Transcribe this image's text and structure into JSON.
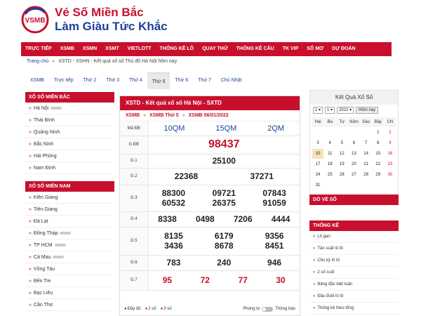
{
  "brand": {
    "logo_text": "VSMB",
    "line1": "Vé Số Miền Bắc",
    "line2": "Làm Giàu Tức Khắc"
  },
  "nav": [
    "TRỰC TIẾP",
    "XSMB",
    "XSMN",
    "XSMT",
    "VIETLOTT",
    "THỐNG KÊ LÔ",
    "QUAY THỬ",
    "THỐNG KÊ CẦU",
    "TK VIP",
    "SỔ MƠ",
    "DỰ ĐOÁN"
  ],
  "breadcrumb": {
    "home": "Trang chủ",
    "current": "XSTD - XSHN - Kết quả xổ số Thủ đô Hà Nội hôm nay"
  },
  "tabs": [
    "XSMB",
    "Trực tiếp",
    "Thứ 2",
    "Thứ 3",
    "Thứ 4",
    "Thứ 5",
    "Thứ 6",
    "Thứ 7",
    "Chủ Nhật"
  ],
  "active_tab": "Thứ 5",
  "sidebar_north": {
    "title": "XỔ SỐ MIỀN BẮC",
    "items": [
      "Hà Nội",
      "Thái Bình",
      "Quảng Ninh",
      "Bắc Ninh",
      "Hải Phòng",
      "Nam Định"
    ]
  },
  "sidebar_south": {
    "title": "XỔ SỐ MIỀN NAM",
    "items": [
      "Kiên Giang",
      "Tiền Giang",
      "Đà Lạt",
      "Đồng Tháp",
      "TP HCM",
      "Cà Mau",
      "Vũng Tàu",
      "Bến Tre",
      "Bạc Liêu",
      "Cần Thơ"
    ]
  },
  "result": {
    "header": "XSTD - Kết quả xổ số Hà Nội - SXTD",
    "sub1": "XSMB",
    "sub2": "XSMB Thứ 5",
    "sub3": "XSMB 06/01/2022",
    "code_label": "Mã ĐB",
    "codes": [
      "10QM",
      "15QM",
      "2QM"
    ],
    "prizes": [
      {
        "label": "G.ĐB",
        "rows": [
          [
            "98437"
          ]
        ],
        "style": "big"
      },
      {
        "label": "G.1",
        "rows": [
          [
            "25100"
          ]
        ]
      },
      {
        "label": "G.2",
        "rows": [
          [
            "22368",
            "37271"
          ]
        ]
      },
      {
        "label": "G.3",
        "rows": [
          [
            "88300",
            "09721",
            "07843"
          ],
          [
            "60532",
            "26375",
            "91059"
          ]
        ]
      },
      {
        "label": "G.4",
        "rows": [
          [
            "8338",
            "0498",
            "7206",
            "4444"
          ]
        ]
      },
      {
        "label": "G.5",
        "rows": [
          [
            "8135",
            "6179",
            "9356"
          ],
          [
            "3436",
            "8678",
            "8451"
          ]
        ]
      },
      {
        "label": "G.6",
        "rows": [
          [
            "783",
            "240",
            "946"
          ]
        ]
      },
      {
        "label": "G.7",
        "rows": [
          [
            "95",
            "72",
            "77",
            "30"
          ]
        ],
        "style": "red"
      }
    ],
    "footer": {
      "opt1": "Đầy đủ",
      "opt2": "2 số",
      "opt3": "3 số",
      "zoom": "Phóng to",
      "alert": "Thông báo"
    }
  },
  "calendar": {
    "title": "Kết Quả Xổ Số",
    "day": "1",
    "month": "1",
    "year": "2022",
    "today_btn": "Hôm nay",
    "weekdays": [
      "Hai",
      "Ba",
      "Tư",
      "Năm",
      "Sáu",
      "Bảy",
      "CN"
    ],
    "cells": [
      "",
      "",
      "",
      "",
      "",
      "1",
      "2",
      "3",
      "4",
      "5",
      "6",
      "7",
      "8",
      "9",
      "10",
      "11",
      "12",
      "13",
      "14",
      "15",
      "16",
      "17",
      "18",
      "19",
      "20",
      "21",
      "22",
      "23",
      "24",
      "25",
      "26",
      "27",
      "28",
      "29",
      "30",
      "31",
      "",
      "",
      "",
      "",
      "",
      ""
    ]
  },
  "do_ve_so": "DÒ VÉ SỐ",
  "thong_ke": {
    "title": "THỐNG KÊ",
    "items": [
      "Lô gan",
      "Tần suất lô tô",
      "Chu kỳ lô tô",
      "2 số cuối",
      "Bảng đặc biệt tuần",
      "Đầu đuôi lô tô",
      "Thống kê theo tổng"
    ]
  }
}
